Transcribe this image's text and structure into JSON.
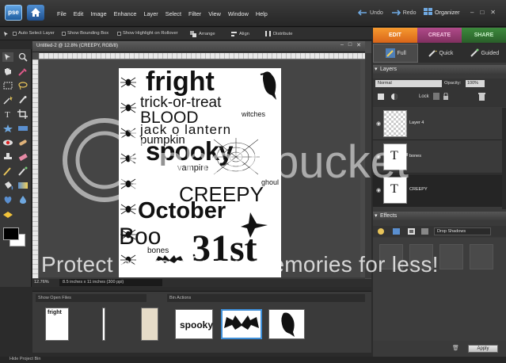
{
  "app": {
    "logo_text": "pse",
    "menu": [
      "File",
      "Edit",
      "Image",
      "Enhance",
      "Layer",
      "Select",
      "Filter",
      "View",
      "Window",
      "Help"
    ],
    "undo_label": "Undo",
    "redo_label": "Redo",
    "organizer_label": "Organizer",
    "win_controls": [
      "–",
      "□",
      "✕"
    ]
  },
  "options_bar": {
    "auto_select": "Auto Select Layer",
    "bounding_box": "Show Bounding Box",
    "highlight": "Show Highlight on Rollover",
    "arrange": "Arrange",
    "align": "Align",
    "distribute": "Distribute"
  },
  "mode_tabs": [
    "EDIT",
    "CREATE",
    "SHARE"
  ],
  "document": {
    "tab_title": "Untitled-2 @ 12.8% (CREEPY, RGB/8)",
    "controls": [
      "–",
      "□",
      "✕"
    ],
    "words": {
      "fright": "fright",
      "trick": "trick-or-treat",
      "witches": "witches",
      "blood": "BLOOD",
      "jack": "jack o lantern",
      "pumpkin": "pumpkin",
      "spooky": "spooky",
      "vampire": "vampire",
      "ghoul": "ghoul",
      "creepy": "CREEPY",
      "october": "October",
      "boo": "Boo",
      "bones": "bones",
      "thirtyfirst": "31st"
    }
  },
  "status": {
    "zoom": "12.76%",
    "size": "8.5 inches x 11 inches (300 ppi)"
  },
  "project_bin": {
    "selector": "Show Open Files",
    "actions": "Bin Actions",
    "hide_label": "Hide Project Bin",
    "thumb_spooky": "spooky",
    "thumb_fright": "fright"
  },
  "right_panel": {
    "subtabs": [
      "Full",
      "Quick",
      "Guided"
    ],
    "layers_title": "Layers",
    "blend_mode": "Normal",
    "opacity_label": "Opacity:",
    "opacity_value": "100%",
    "lock_label": "Lock",
    "layers": [
      {
        "name": "Layer 4"
      },
      {
        "name": "bones"
      },
      {
        "name": "CREEPY"
      }
    ],
    "effects_title": "Effects",
    "effects_dropdown": "Drop Shadows",
    "apply_label": "Apply"
  },
  "watermark": {
    "text": "Protect more of your memories for less!",
    "logo_text": "photobucket"
  }
}
